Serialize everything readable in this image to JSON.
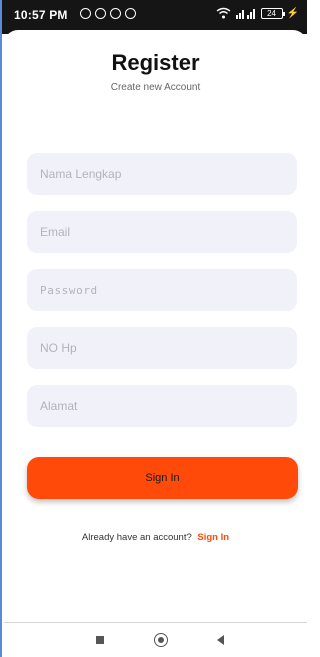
{
  "status_bar": {
    "time": "10:57 PM",
    "battery": "24"
  },
  "register": {
    "title": "Register",
    "subtitle": "Create new Account",
    "fields": [
      {
        "placeholder": "Nama Lengkap"
      },
      {
        "placeholder": "Email"
      },
      {
        "placeholder": "Password"
      },
      {
        "placeholder": "NO Hp"
      },
      {
        "placeholder": "Alamat"
      }
    ],
    "submit_label": "Sign In",
    "footer_text": "Already have an account?",
    "footer_link": "Sign In"
  },
  "colors": {
    "accent": "#ff4a0a",
    "field_bg": "#f1f2f9",
    "status_bar_bg": "#151515"
  }
}
